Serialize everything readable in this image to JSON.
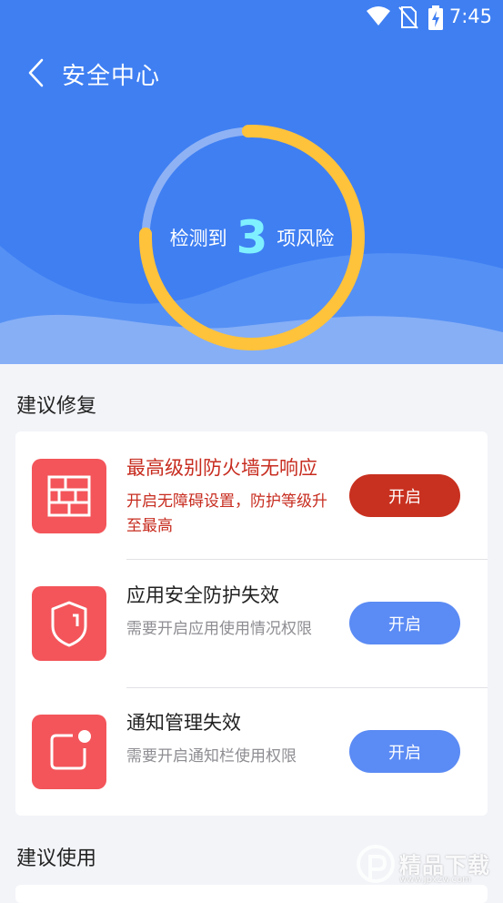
{
  "status_bar": {
    "time": "7:45",
    "icons": [
      "wifi-icon",
      "no-sim-icon",
      "battery-charging-icon"
    ]
  },
  "header": {
    "title": "安全中心",
    "back_icon": "back-arrow-icon",
    "risk_prefix": "检测到",
    "risk_count": "3",
    "risk_suffix": "项风险",
    "colors": {
      "background": "#3f7ff2",
      "ring": "#ffc23b",
      "count": "#7ff0ff"
    }
  },
  "sections": {
    "recommend_fix": "建议修复",
    "recommend_use": "建议使用"
  },
  "fix_items": [
    {
      "icon": "firewall-icon",
      "title": "最高级别防火墙无响应",
      "desc": "开启无障碍设置，防护等级升至最高",
      "button": "开启",
      "severity": "danger"
    },
    {
      "icon": "shield-icon",
      "title": "应用安全防护失效",
      "desc": "需要开启应用使用情况权限",
      "button": "开启",
      "severity": "normal"
    },
    {
      "icon": "notification-icon",
      "title": "通知管理失效",
      "desc": "需要开启通知栏使用权限",
      "button": "开启",
      "severity": "normal"
    }
  ],
  "watermark": {
    "text": "精品下载",
    "url": "www.jpxzw.com"
  }
}
